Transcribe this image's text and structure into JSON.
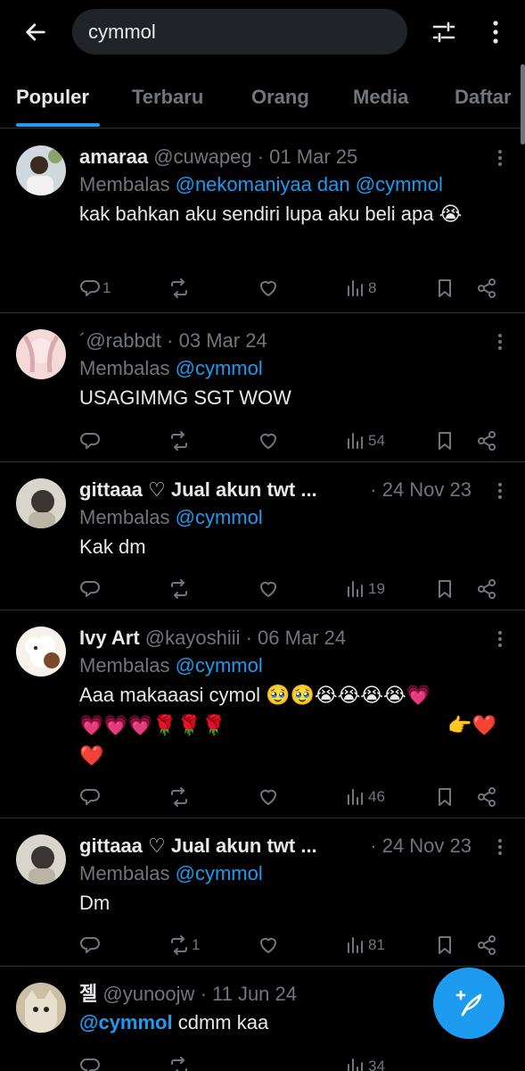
{
  "search": {
    "value": "cymmol"
  },
  "icons": {
    "back": "arrow-left-icon",
    "filter": "sliders-icon",
    "more": "vertical-dots-icon",
    "compose": "feather-plus-icon"
  },
  "colors": {
    "accent": "#1d9bf0",
    "background": "#000000",
    "muted": "#71767b",
    "text": "#e7e9ea"
  },
  "tabs": [
    {
      "label": "Populer",
      "active": true
    },
    {
      "label": "Terbaru",
      "active": false
    },
    {
      "label": "Orang",
      "active": false
    },
    {
      "label": "Media",
      "active": false
    },
    {
      "label": "Daftar",
      "active": false
    }
  ],
  "posts": [
    {
      "name": "amaraa",
      "handle": "@cuwapeg",
      "date": "· 01 Mar 25",
      "reply_prefix": "Membalas",
      "reply_to": "@nekomaniyaa dan @cymmol",
      "text": "kak bahkan aku sendiri lupa aku beli apa 😭",
      "replies": "1",
      "reposts": "",
      "views": "8"
    },
    {
      "name": "",
      "handle": "´@rabbdt",
      "date": "· 03 Mar 24",
      "reply_prefix": "Membalas",
      "reply_to": "@cymmol",
      "text": "USAGIMMG SGT WOW",
      "replies": "",
      "reposts": "",
      "views": "54"
    },
    {
      "name": "gittaaa ♡ Jual akun twt ...",
      "handle": "",
      "date": "· 24 Nov 23",
      "reply_prefix": "Membalas",
      "reply_to": "@cymmol",
      "text": "Kak dm",
      "replies": "",
      "reposts": "",
      "views": "19"
    },
    {
      "name": "Ivy Art",
      "handle": "@kayoshiii",
      "date": "· 06 Mar 24",
      "reply_prefix": "Membalas",
      "reply_to": "@cymmol",
      "text_lines": [
        "Aaa makaaasi cymol 🥹🥹😭😭😭😭💗",
        "💗💗💗🌹🌹🌹",
        "❤️"
      ],
      "text_right": "👉❤️",
      "replies": "",
      "reposts": "",
      "views": "46"
    },
    {
      "name": "gittaaa ♡ Jual akun twt ...",
      "handle": "",
      "date": "· 24 Nov 23",
      "reply_prefix": "Membalas",
      "reply_to": "@cymmol",
      "text": "Dm",
      "replies": "",
      "reposts": "1",
      "views": "81"
    },
    {
      "name": "젤",
      "handle": "@yunoojw",
      "date": "· 11 Jun 24",
      "mention": "@cymmol",
      "text": " cdmm kaa",
      "replies": "",
      "reposts": "",
      "views": "34"
    }
  ]
}
